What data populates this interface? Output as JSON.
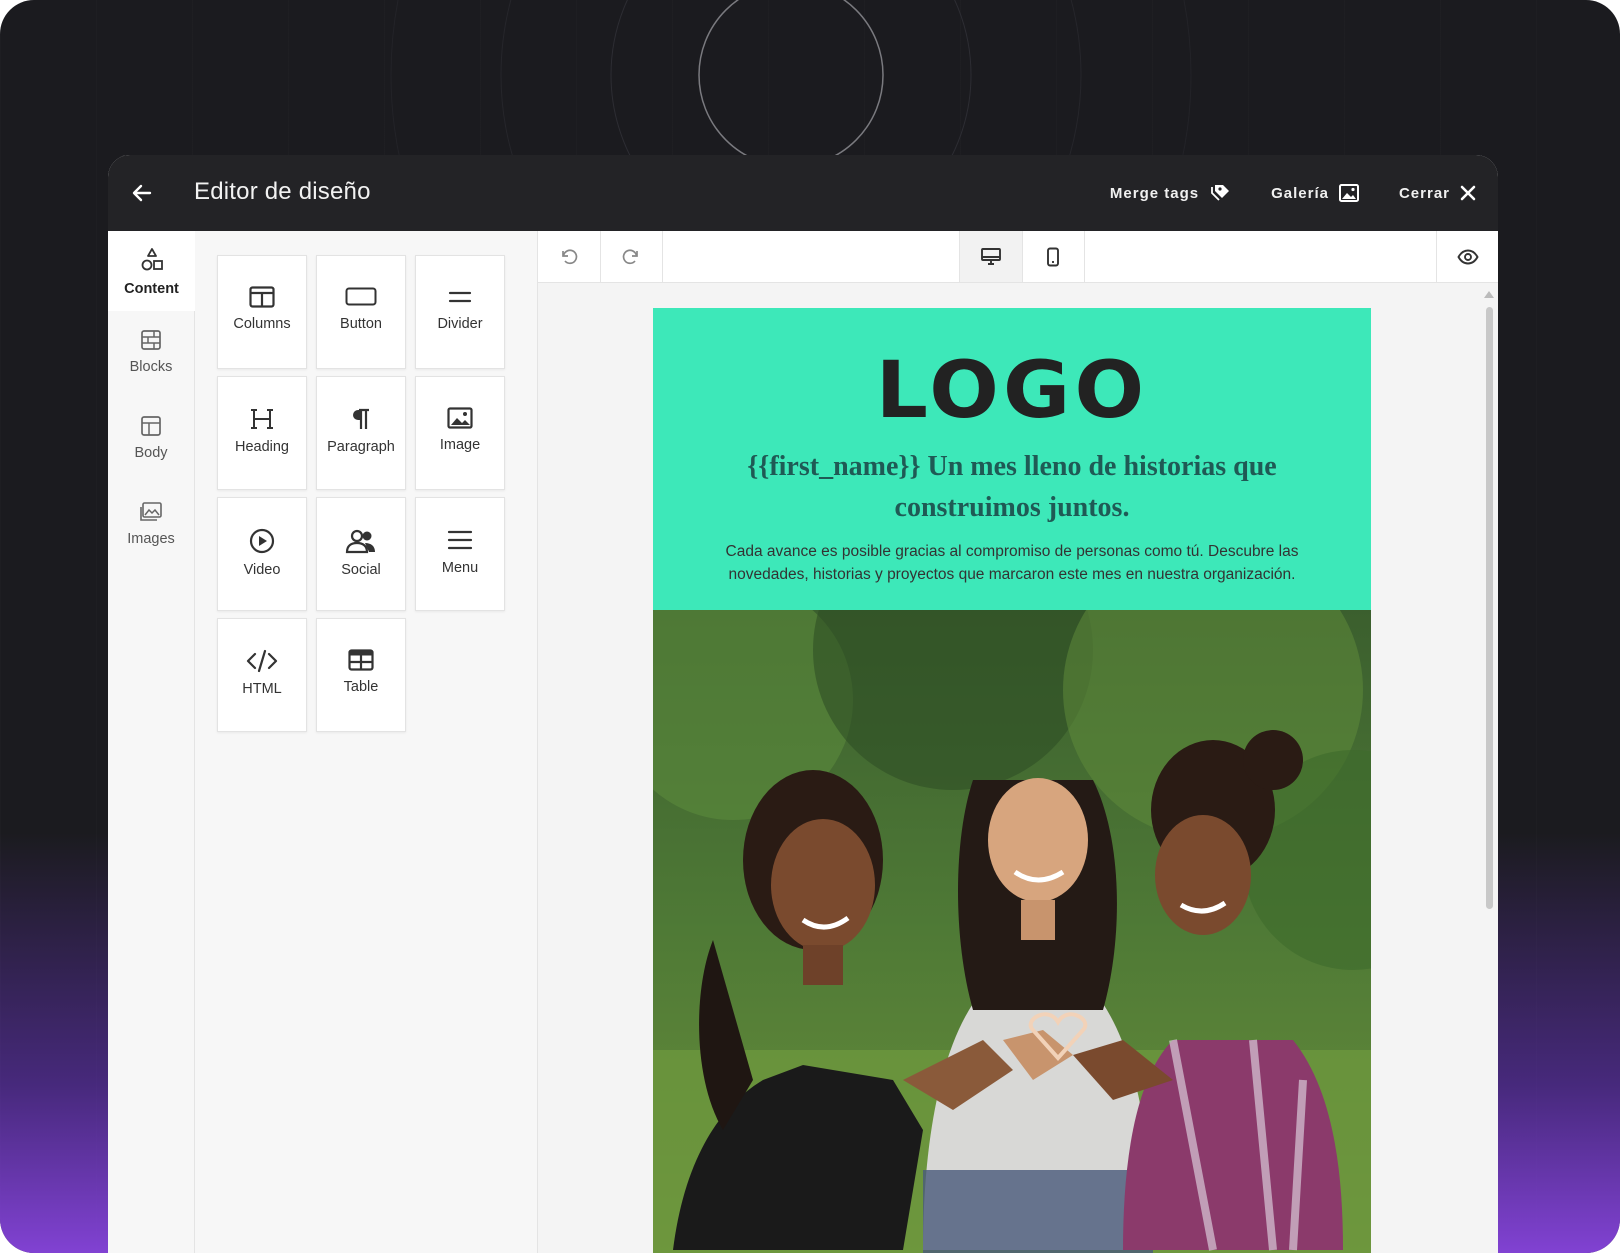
{
  "header": {
    "title": "Editor de diseño",
    "actions": [
      {
        "label": "Merge tags",
        "icon": "tag-icon"
      },
      {
        "label": "Galería",
        "icon": "image-icon"
      },
      {
        "label": "Cerrar",
        "icon": "close-icon"
      }
    ]
  },
  "rail": {
    "items": [
      {
        "label": "Content",
        "icon": "shapes-icon",
        "active": true
      },
      {
        "label": "Blocks",
        "icon": "blocks-icon",
        "active": false
      },
      {
        "label": "Body",
        "icon": "layout-icon",
        "active": false
      },
      {
        "label": "Images",
        "icon": "images-icon",
        "active": false
      }
    ]
  },
  "tools": [
    {
      "label": "Columns",
      "icon": "columns-icon"
    },
    {
      "label": "Button",
      "icon": "button-icon"
    },
    {
      "label": "Divider",
      "icon": "divider-icon"
    },
    {
      "label": "Heading",
      "icon": "heading-icon"
    },
    {
      "label": "Paragraph",
      "icon": "paragraph-icon"
    },
    {
      "label": "Image",
      "icon": "image-icon"
    },
    {
      "label": "Video",
      "icon": "video-icon"
    },
    {
      "label": "Social",
      "icon": "social-icon"
    },
    {
      "label": "Menu",
      "icon": "menu-icon"
    },
    {
      "label": "HTML",
      "icon": "code-icon"
    },
    {
      "label": "Table",
      "icon": "table-icon"
    }
  ],
  "toolbar": {
    "undo": "undo-icon",
    "redo": "redo-icon",
    "desktop": "desktop-icon",
    "mobile": "mobile-icon",
    "preview": "eye-icon",
    "active_view": "desktop"
  },
  "email": {
    "logo": "LOGO",
    "headline": "{{first_name}} Un mes lleno de historias que construimos juntos.",
    "body": "Cada avance es posible gracias al compromiso de personas como tú. Descubre las novedades, historias y proyectos que marcaron este mes en nuestra organización.",
    "hero_color": "#3de8b9"
  },
  "colors": {
    "topbar": "#232326",
    "accent_gradient": "#7c3aed"
  }
}
